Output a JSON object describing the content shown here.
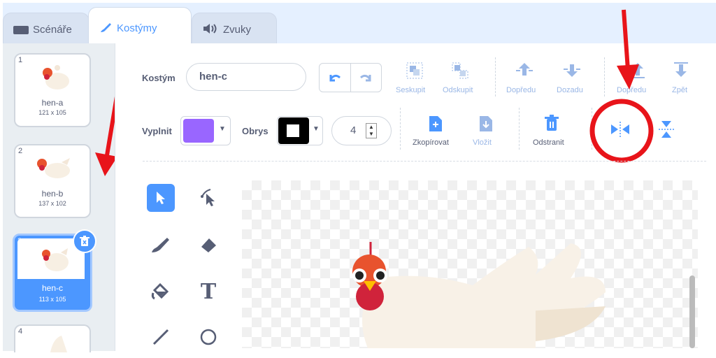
{
  "tabs": [
    {
      "label": "Scénáře",
      "icon": "code-icon"
    },
    {
      "label": "Kostýmy",
      "icon": "paintbrush-icon"
    },
    {
      "label": "Zvuky",
      "icon": "speaker-icon"
    }
  ],
  "costumes": [
    {
      "number": "1",
      "name": "hen-a",
      "size": "121 x 105"
    },
    {
      "number": "2",
      "name": "hen-b",
      "size": "137 x 102"
    },
    {
      "number": "3",
      "name": "hen-c",
      "size": "113 x 105",
      "selected": true
    },
    {
      "number": "4"
    }
  ],
  "editor": {
    "costume_label": "Kostým",
    "costume_name": "hen-c",
    "fill_label": "Vyplnit",
    "outline_label": "Obrys",
    "outline_width": "4",
    "group_label": "Seskupit",
    "ungroup_label": "Odskupit",
    "forward_label": "Dopředu",
    "backward_label": "Dozadu",
    "front_label": "Dopředu",
    "back_label": "Zpět",
    "copy_label": "Zkopírovat",
    "paste_label": "Vložit",
    "delete_label": "Odstranit",
    "text_tool": "T"
  },
  "colors": {
    "accent": "#4c97ff",
    "fill": "#9966ff",
    "outline": "#000000",
    "annotation": "#e8141a"
  }
}
